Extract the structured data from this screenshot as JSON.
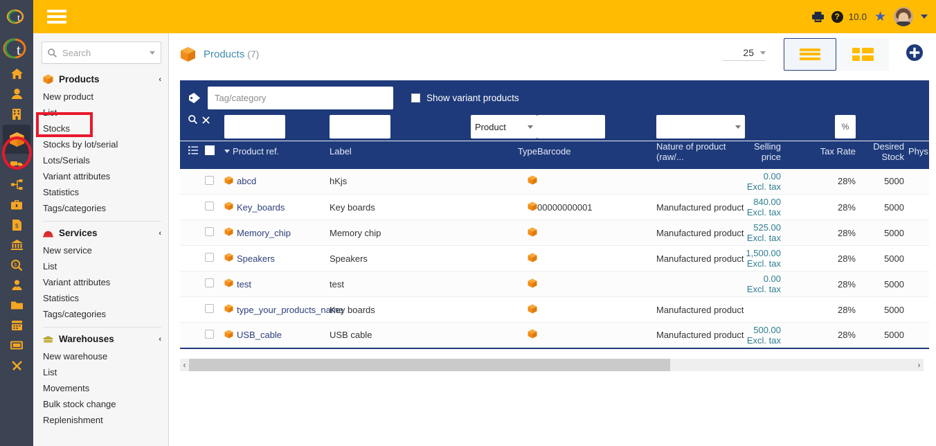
{
  "topbar": {
    "menu_icon": "hamburger-menu-icon",
    "print_icon": "printer-icon",
    "help_icon": "help-question-icon",
    "help_label": "?",
    "version": "10.0",
    "star_icon": "star-icon",
    "star_glyph": "★",
    "avatar_icon": "user-avatar",
    "dropdown_icon": "chevron-down-icon"
  },
  "rail": {
    "logo_small": "dolibarr-logo-small",
    "logo_large": "dolibarr-logo-large",
    "items": [
      {
        "name": "home-icon"
      },
      {
        "name": "user-icon"
      },
      {
        "name": "building-icon"
      },
      {
        "name": "box-products-icon",
        "active": true
      },
      {
        "name": "truck-shipping-icon"
      },
      {
        "name": "sitemap-project-icon"
      },
      {
        "name": "briefcase-icon"
      },
      {
        "name": "invoice-dollar-icon"
      },
      {
        "name": "bank-icon"
      },
      {
        "name": "money-search-icon"
      },
      {
        "name": "agent-user-icon"
      },
      {
        "name": "folder-icon"
      },
      {
        "name": "calendar-icon"
      },
      {
        "name": "ticket-icon"
      },
      {
        "name": "tools-icon"
      }
    ]
  },
  "sidebar": {
    "search": {
      "placeholder": "Search",
      "icon": "search-icon",
      "caret": "chevron-down-icon"
    },
    "groups": [
      {
        "title": "Products",
        "icon": "box-icon",
        "chevron": "‹",
        "items": [
          {
            "label": "New product",
            "highlighted": false
          },
          {
            "label": "List",
            "highlighted": true
          },
          {
            "label": "Stocks",
            "highlighted": false
          },
          {
            "label": "Stocks by lot/serial",
            "highlighted": false
          },
          {
            "label": "Lots/Serials",
            "highlighted": false
          },
          {
            "label": "Variant attributes",
            "highlighted": false
          },
          {
            "label": "Statistics",
            "highlighted": false
          },
          {
            "label": "Tags/categories",
            "highlighted": false
          }
        ]
      },
      {
        "title": "Services",
        "icon": "service-bell-icon",
        "chevron": "‹",
        "items": [
          {
            "label": "New service"
          },
          {
            "label": "List"
          },
          {
            "label": "Variant attributes"
          },
          {
            "label": "Statistics"
          },
          {
            "label": "Tags/categories"
          }
        ]
      },
      {
        "title": "Warehouses",
        "icon": "warehouse-icon",
        "chevron": "‹",
        "items": [
          {
            "label": "New warehouse"
          },
          {
            "label": "List"
          },
          {
            "label": "Movements"
          },
          {
            "label": "Bulk stock change"
          },
          {
            "label": "Replenishment"
          }
        ]
      }
    ]
  },
  "page": {
    "icon": "box-products-icon",
    "title": "Products",
    "count": "(7)",
    "per_page": "25",
    "per_page_caret": "chevron-down-icon",
    "view_list_icon": "list-view-icon",
    "view_grid_icon": "grid-view-icon",
    "add_icon": "plus-circle-add-icon"
  },
  "filters": {
    "tag_icon": "tag-icon",
    "tag_placeholder": "Tag/category",
    "show_variants_label": "Show variant products",
    "show_variants_checked": false,
    "search_icon": "search-icon",
    "clear_icon": "close-x-icon",
    "list_icon": "list-lines-icon",
    "select_all_checkbox": false,
    "type_value": "Product",
    "tax_symbol": "%"
  },
  "table": {
    "columns": [
      {
        "key": "ref",
        "label": "Product ref.",
        "sorted": true,
        "align": "left"
      },
      {
        "key": "label",
        "label": "Label",
        "align": "left"
      },
      {
        "key": "type",
        "label": "Type",
        "align": "right"
      },
      {
        "key": "barcode",
        "label": "Barcode",
        "align": "left"
      },
      {
        "key": "nature",
        "label": "Nature of product (raw/...",
        "align": "left"
      },
      {
        "key": "price",
        "label": "Selling price",
        "align": "right"
      },
      {
        "key": "tax",
        "label": "Tax Rate",
        "align": "right"
      },
      {
        "key": "desired",
        "label": "Desired Stock",
        "align": "right"
      },
      {
        "key": "phys",
        "label": "Phys",
        "align": "right"
      }
    ],
    "rows": [
      {
        "ref": "abcd",
        "label": "hKjs",
        "type_icon": "box-icon",
        "barcode": "",
        "nature": "",
        "price": "0.00 Excl. tax",
        "tax": "28%",
        "desired": "5000",
        "phys": ""
      },
      {
        "ref": "Key_boards",
        "label": "Key boards",
        "type_icon": "box-icon",
        "barcode": "00000000001",
        "nature": "Manufactured product",
        "price": "840.00 Excl. tax",
        "tax": "28%",
        "desired": "5000",
        "phys": ""
      },
      {
        "ref": "Memory_chip",
        "label": "Memory chip",
        "type_icon": "box-icon",
        "barcode": "",
        "nature": "Manufactured product",
        "price": "525.00 Excl. tax",
        "tax": "28%",
        "desired": "5000",
        "phys": ""
      },
      {
        "ref": "Speakers",
        "label": "Speakers",
        "type_icon": "box-icon",
        "barcode": "",
        "nature": "Manufactured product",
        "price": "1,500.00 Excl. tax",
        "tax": "28%",
        "desired": "5000",
        "phys": ""
      },
      {
        "ref": "test",
        "label": "test",
        "type_icon": "box-icon",
        "barcode": "",
        "nature": "",
        "price": "0.00 Excl. tax",
        "tax": "28%",
        "desired": "5000",
        "phys": ""
      },
      {
        "ref": "type_your_products_name",
        "label": "Key boards",
        "type_icon": "box-icon",
        "barcode": "",
        "nature": "Manufactured product",
        "price": "",
        "tax": "28%",
        "desired": "5000",
        "phys": ""
      },
      {
        "ref": "USB_cable",
        "label": "USB cable",
        "type_icon": "box-icon",
        "barcode": "",
        "nature": "Manufactured product",
        "price": "500.00 Excl. tax",
        "tax": "28%",
        "desired": "5000",
        "phys": ""
      }
    ]
  },
  "scrollbar": {
    "left_arrow": "‹",
    "right_arrow": "›"
  },
  "colors": {
    "header": "#ffbb00",
    "rail": "#3c4353",
    "filter_bar": "#1e3a7a",
    "accent_orange": "#f5a623",
    "link_blue": "#2b3f7a",
    "price_teal": "#2e7d8f",
    "highlight_red": "#e8192c"
  }
}
